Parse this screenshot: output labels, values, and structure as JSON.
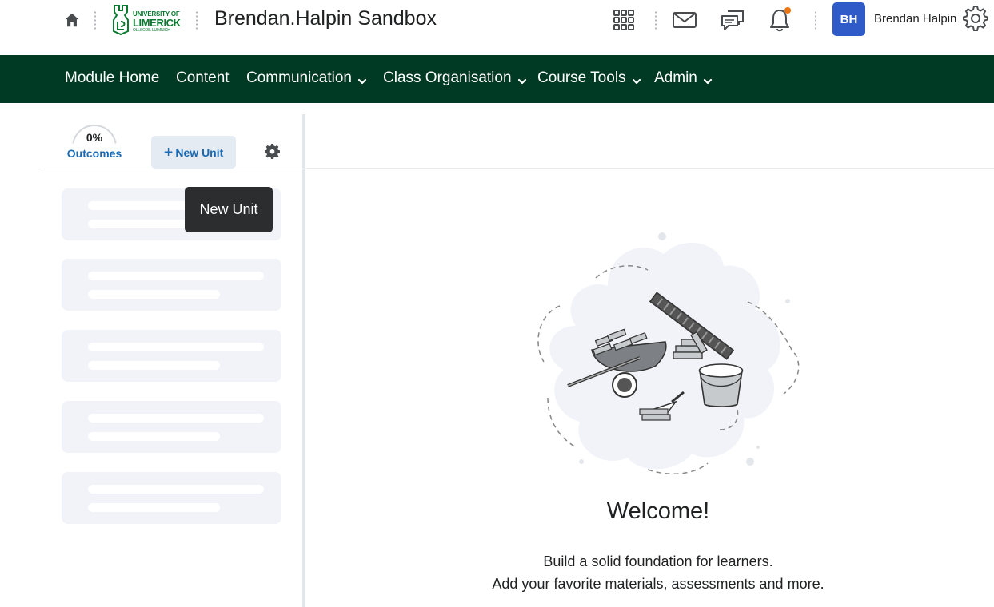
{
  "header": {
    "logo": {
      "line1": "UNIVERSITY OF",
      "line2": "LIMERICK",
      "line3": "OLLSCOIL LUIMNIGH"
    },
    "course_title": "Brendan.Halpin Sandbox",
    "user": {
      "initials": "BH",
      "name": "Brendan Halpin"
    },
    "icons": [
      "home-icon",
      "apps-grid-icon",
      "mail-icon",
      "chat-icon",
      "bell-icon",
      "gear-icon"
    ],
    "notification_color": "#e87511"
  },
  "nav": {
    "items": [
      {
        "label": "Module Home",
        "has_menu": false
      },
      {
        "label": "Content",
        "has_menu": false
      },
      {
        "label": "Communication",
        "has_menu": true
      },
      {
        "label": "Class Organisation",
        "has_menu": true
      },
      {
        "label": "Course Tools",
        "has_menu": true
      },
      {
        "label": "Admin",
        "has_menu": true
      }
    ],
    "background": "#003a25"
  },
  "sidebar": {
    "outcomes_percent": "0%",
    "outcomes_label": "Outcomes",
    "new_unit_label": "New Unit",
    "tooltip": "New Unit",
    "placeholder_count": 5
  },
  "main": {
    "welcome_title": "Welcome!",
    "description_line1": "Build a solid foundation for learners.",
    "description_line2": "Add your favorite materials, assessments and more."
  },
  "colors": {
    "accent": "#1a6ab3",
    "brand_green": "#0a7a2f",
    "avatar": "#2e5bc7"
  }
}
